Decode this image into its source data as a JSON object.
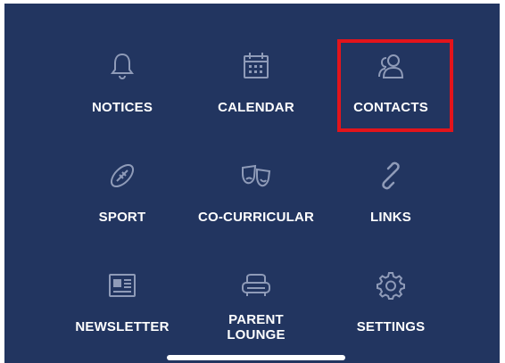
{
  "menu": {
    "items": [
      {
        "id": "notices",
        "label": "NOTICES",
        "icon": "bell-icon"
      },
      {
        "id": "calendar",
        "label": "CALENDAR",
        "icon": "calendar-icon"
      },
      {
        "id": "contacts",
        "label": "CONTACTS",
        "icon": "contacts-icon"
      },
      {
        "id": "sport",
        "label": "SPORT",
        "icon": "football-icon"
      },
      {
        "id": "co-curricular",
        "label": "CO-CURRICULAR",
        "icon": "theatre-masks-icon"
      },
      {
        "id": "links",
        "label": "LINKS",
        "icon": "link-icon"
      },
      {
        "id": "newsletter",
        "label": "NEWSLETTER",
        "icon": "newspaper-icon"
      },
      {
        "id": "parent-lounge",
        "label": "PARENT\nLOUNGE",
        "icon": "sofa-icon"
      },
      {
        "id": "settings",
        "label": "SETTINGS",
        "icon": "gear-icon"
      }
    ]
  },
  "highlight": {
    "item": "contacts",
    "color": "#e3141b"
  },
  "colors": {
    "background": "#223560",
    "icon": "#8f9bb8",
    "text": "#ffffff"
  }
}
